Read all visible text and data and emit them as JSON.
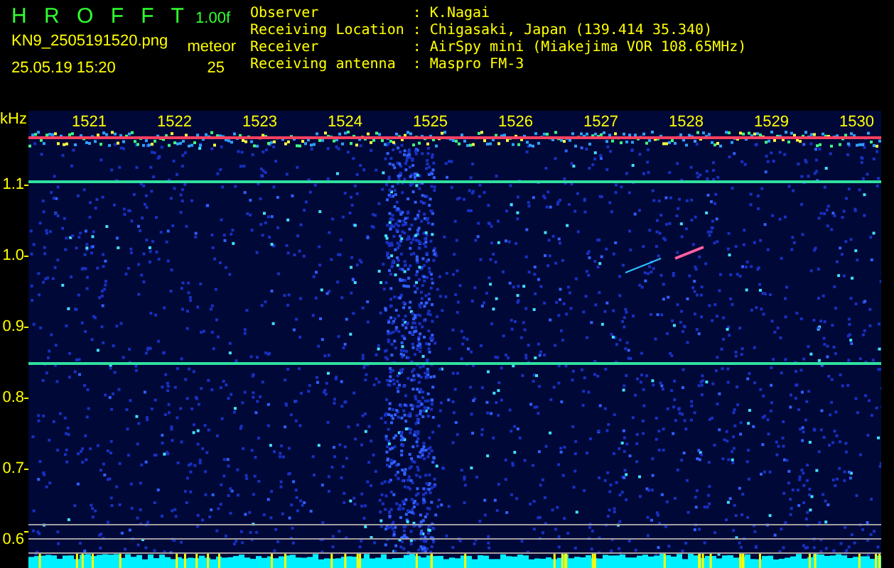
{
  "header": {
    "app_title": "H R O F F T",
    "version": "1.00f",
    "filename": "KN9_2505191520.png",
    "timestamp": "25.05.19 15:20",
    "count_label": "meteor",
    "count": "25"
  },
  "separator": ":",
  "info": [
    {
      "label": "Observer",
      "value": "K.Nagai"
    },
    {
      "label": "Receiving Location",
      "value": "Chigasaki, Japan (139.414 35.340)"
    },
    {
      "label": "Receiver",
      "value": "AirSpy mini (Miakejima VOR 108.65MHz)"
    },
    {
      "label": "Receiving antenna",
      "value": "Maspro FM-3"
    }
  ],
  "spectrogram": {
    "unit": "kHz",
    "x_labels": [
      "1521",
      "1522",
      "1523",
      "1524",
      "1525",
      "1526",
      "1527",
      "1528",
      "1529",
      "1530"
    ],
    "y_labels": [
      "1.1",
      "1.0",
      "0.9",
      "0.8",
      "0.7",
      "0.6"
    ]
  }
}
